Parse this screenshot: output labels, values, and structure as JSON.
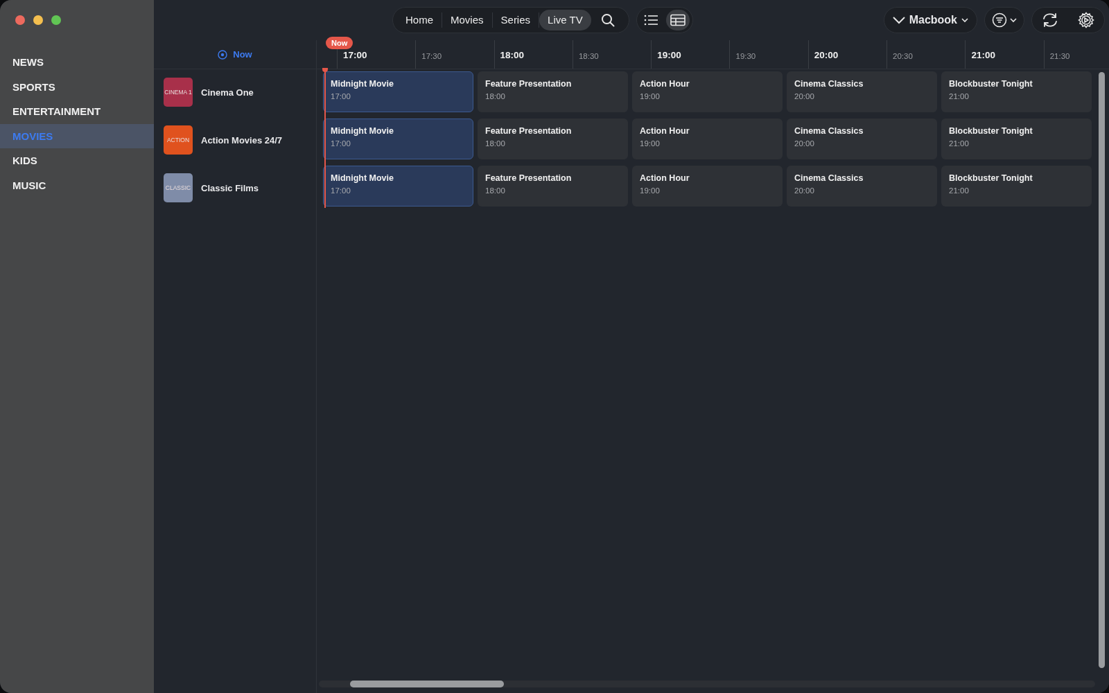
{
  "sidebar": {
    "items": [
      {
        "label": "NEWS",
        "selected": false
      },
      {
        "label": "SPORTS",
        "selected": false
      },
      {
        "label": "ENTERTAINMENT",
        "selected": false
      },
      {
        "label": "MOVIES",
        "selected": true
      },
      {
        "label": "KIDS",
        "selected": false
      },
      {
        "label": "MUSIC",
        "selected": false
      }
    ]
  },
  "nav": {
    "tabs": [
      {
        "label": "Home",
        "selected": false
      },
      {
        "label": "Movies",
        "selected": false
      },
      {
        "label": "Series",
        "selected": false
      },
      {
        "label": "Live TV",
        "selected": true
      }
    ],
    "views": [
      {
        "kind": "list",
        "selected": false
      },
      {
        "kind": "grid",
        "selected": true
      }
    ],
    "device": "Macbook"
  },
  "guide": {
    "now_button": "Now",
    "now_badge": "Now",
    "ticks": [
      {
        "label": "17:00",
        "kind": "major"
      },
      {
        "label": "17:30",
        "kind": "minor"
      },
      {
        "label": "18:00",
        "kind": "major"
      },
      {
        "label": "18:30",
        "kind": "minor"
      },
      {
        "label": "19:00",
        "kind": "major"
      },
      {
        "label": "19:30",
        "kind": "minor"
      },
      {
        "label": "20:00",
        "kind": "major"
      },
      {
        "label": "20:30",
        "kind": "minor"
      },
      {
        "label": "21:00",
        "kind": "major"
      },
      {
        "label": "21:30",
        "kind": "minor"
      }
    ],
    "channels": [
      {
        "name": "Cinema One",
        "logo": "CINEMA 1",
        "color": "#a8304a",
        "programs": [
          {
            "title": "Midnight Movie",
            "time": "17:00",
            "current": true
          },
          {
            "title": "Feature Presentation",
            "time": "18:00",
            "current": false
          },
          {
            "title": "Action Hour",
            "time": "19:00",
            "current": false
          },
          {
            "title": "Cinema Classics",
            "time": "20:00",
            "current": false
          },
          {
            "title": "Blockbuster Tonight",
            "time": "21:00",
            "current": false
          }
        ]
      },
      {
        "name": "Action Movies 24/7",
        "logo": "ACTION",
        "color": "#e0521e",
        "programs": [
          {
            "title": "Midnight Movie",
            "time": "17:00",
            "current": true
          },
          {
            "title": "Feature Presentation",
            "time": "18:00",
            "current": false
          },
          {
            "title": "Action Hour",
            "time": "19:00",
            "current": false
          },
          {
            "title": "Cinema Classics",
            "time": "20:00",
            "current": false
          },
          {
            "title": "Blockbuster Tonight",
            "time": "21:00",
            "current": false
          }
        ]
      },
      {
        "name": "Classic Films",
        "logo": "CLASSIC",
        "color": "#7f8ca8",
        "programs": [
          {
            "title": "Midnight Movie",
            "time": "17:00",
            "current": true
          },
          {
            "title": "Feature Presentation",
            "time": "18:00",
            "current": false
          },
          {
            "title": "Action Hour",
            "time": "19:00",
            "current": false
          },
          {
            "title": "Cinema Classics",
            "time": "20:00",
            "current": false
          },
          {
            "title": "Blockbuster Tonight",
            "time": "21:00",
            "current": false
          }
        ]
      }
    ]
  }
}
